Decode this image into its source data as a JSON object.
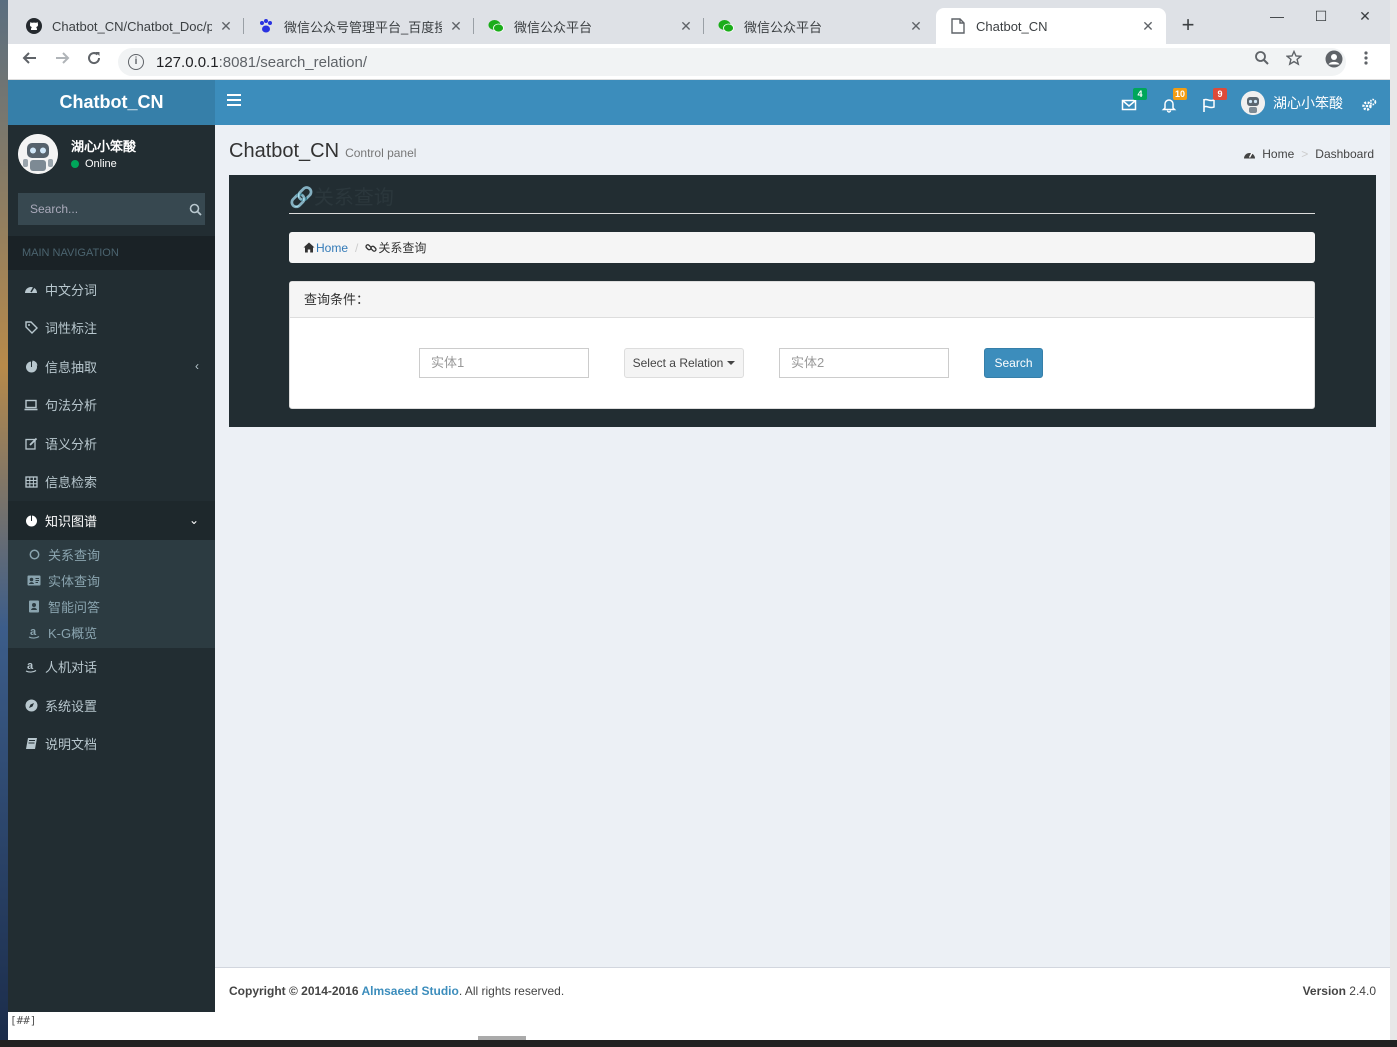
{
  "browser": {
    "tabs": [
      {
        "title": "Chatbot_CN/Chatbot_Doc/p",
        "icon": "github-icon"
      },
      {
        "title": "微信公众号管理平台_百度搜索",
        "icon": "baidu-paw-icon"
      },
      {
        "title": "微信公众平台",
        "icon": "wechat-icon"
      },
      {
        "title": "微信公众平台",
        "icon": "wechat-icon"
      },
      {
        "title": "Chatbot_CN",
        "icon": "page-icon"
      }
    ],
    "url_host": "127.0.0.1",
    "url_path": ":8081/search_relation/"
  },
  "app": {
    "logo": "Chatbot_CN",
    "notifications": {
      "mail": "4",
      "bell": "10",
      "flag": "9"
    },
    "user": {
      "name": "湖心小笨酸",
      "status": "Online"
    },
    "sidebar_search_placeholder": "Search...",
    "nav_header": "MAIN NAVIGATION",
    "menu": [
      {
        "label": "中文分词",
        "icon": "dashboard-icon"
      },
      {
        "label": "词性标注",
        "icon": "tag-icon"
      },
      {
        "label": "信息抽取",
        "icon": "pie-chart-icon"
      },
      {
        "label": "句法分析",
        "icon": "laptop-icon"
      },
      {
        "label": "语义分析",
        "icon": "edit-icon"
      },
      {
        "label": "信息检索",
        "icon": "table-icon"
      },
      {
        "label": "知识图谱",
        "icon": "pie-chart-icon"
      }
    ],
    "submenu": [
      {
        "label": "关系查询",
        "icon": "circle-icon"
      },
      {
        "label": "实体查询",
        "icon": "id-card-icon"
      },
      {
        "label": "智能问答",
        "icon": "contact-book-icon"
      },
      {
        "label": "K-G概览",
        "icon": "amazon-icon"
      }
    ],
    "menu_after": [
      {
        "label": "人机对话",
        "icon": "amazon-icon"
      },
      {
        "label": "系统设置",
        "icon": "compass-icon"
      },
      {
        "label": "说明文档",
        "icon": "book-icon"
      }
    ],
    "content_title": "Chatbot_CN",
    "content_subtitle": "Control panel",
    "crumbs": {
      "home": "Home",
      "current": "Dashboard"
    },
    "page_title": "关系查询",
    "inner_crumbs": {
      "home": "Home",
      "current": "关系查询"
    },
    "query": {
      "header": "查询条件：",
      "entity1_placeholder": "实体1",
      "relation_label": "Select a Relation",
      "entity2_placeholder": "实体2",
      "search_label": "Search"
    },
    "footer": {
      "copyright": "Copyright © 2014-2016 ",
      "studio": "Almsaeed Studio",
      "rights": ". All rights reserved.",
      "version_label": "Version",
      "version": "2.4.0"
    },
    "bottom_text": "[##]"
  },
  "colors": {
    "navbar": "#3c8dbc",
    "logo_bg": "#367fa9",
    "sidebar": "#222d32",
    "online": "#00a65a",
    "badge_mail": "#00a65a",
    "badge_bell": "#f39c12",
    "badge_flag": "#dd4b39"
  }
}
